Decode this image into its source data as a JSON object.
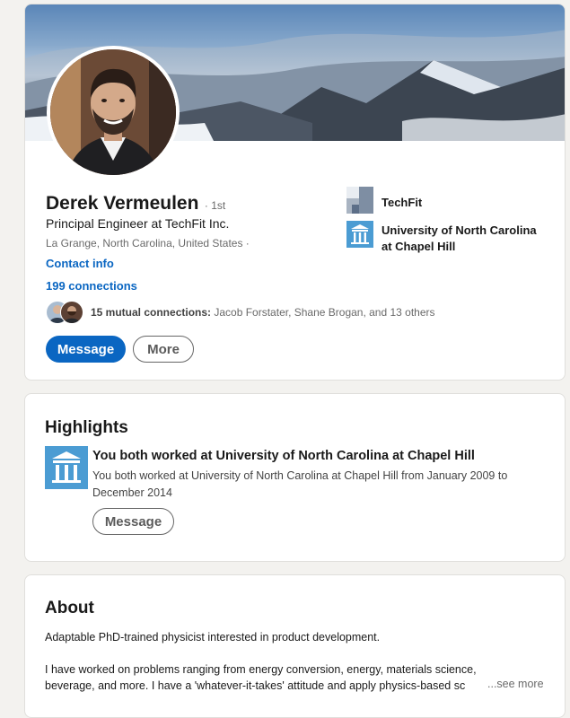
{
  "profile": {
    "name": "Derek Vermeulen",
    "degree": "· 1st",
    "headline": "Principal Engineer at TechFit Inc.",
    "location": "La Grange, North Carolina, United States ·",
    "contact_info": "Contact info",
    "connections": "199 connections",
    "mutual_count": "15 mutual connections:",
    "mutual_names": " Jacob Forstater, Shane Brogan, and 13 others",
    "message_label": "Message",
    "more_label": "More",
    "experience": [
      {
        "name": "TechFit"
      },
      {
        "name": "University of North Carolina at Chapel Hill"
      }
    ]
  },
  "highlights": {
    "title": "Highlights",
    "item_title": "You both worked at University of North Carolina at Chapel Hill",
    "item_desc": "You both worked at University of North Carolina at Chapel Hill from January 2009 to December 2014",
    "message_label": "Message"
  },
  "about": {
    "title": "About",
    "paragraph1": "Adaptable PhD-trained physicist interested in product development.",
    "paragraph2_line1": "I have worked on problems ranging from energy conversion, energy, materials science,",
    "paragraph2_line2": "beverage, and more. I have a 'whatever-it-takes' attitude and apply physics-based sc",
    "see_more": "...see more"
  },
  "colors": {
    "accent": "#0a66c2",
    "unc_blue": "#4b9cd3",
    "page_bg": "#f3f2ef"
  }
}
